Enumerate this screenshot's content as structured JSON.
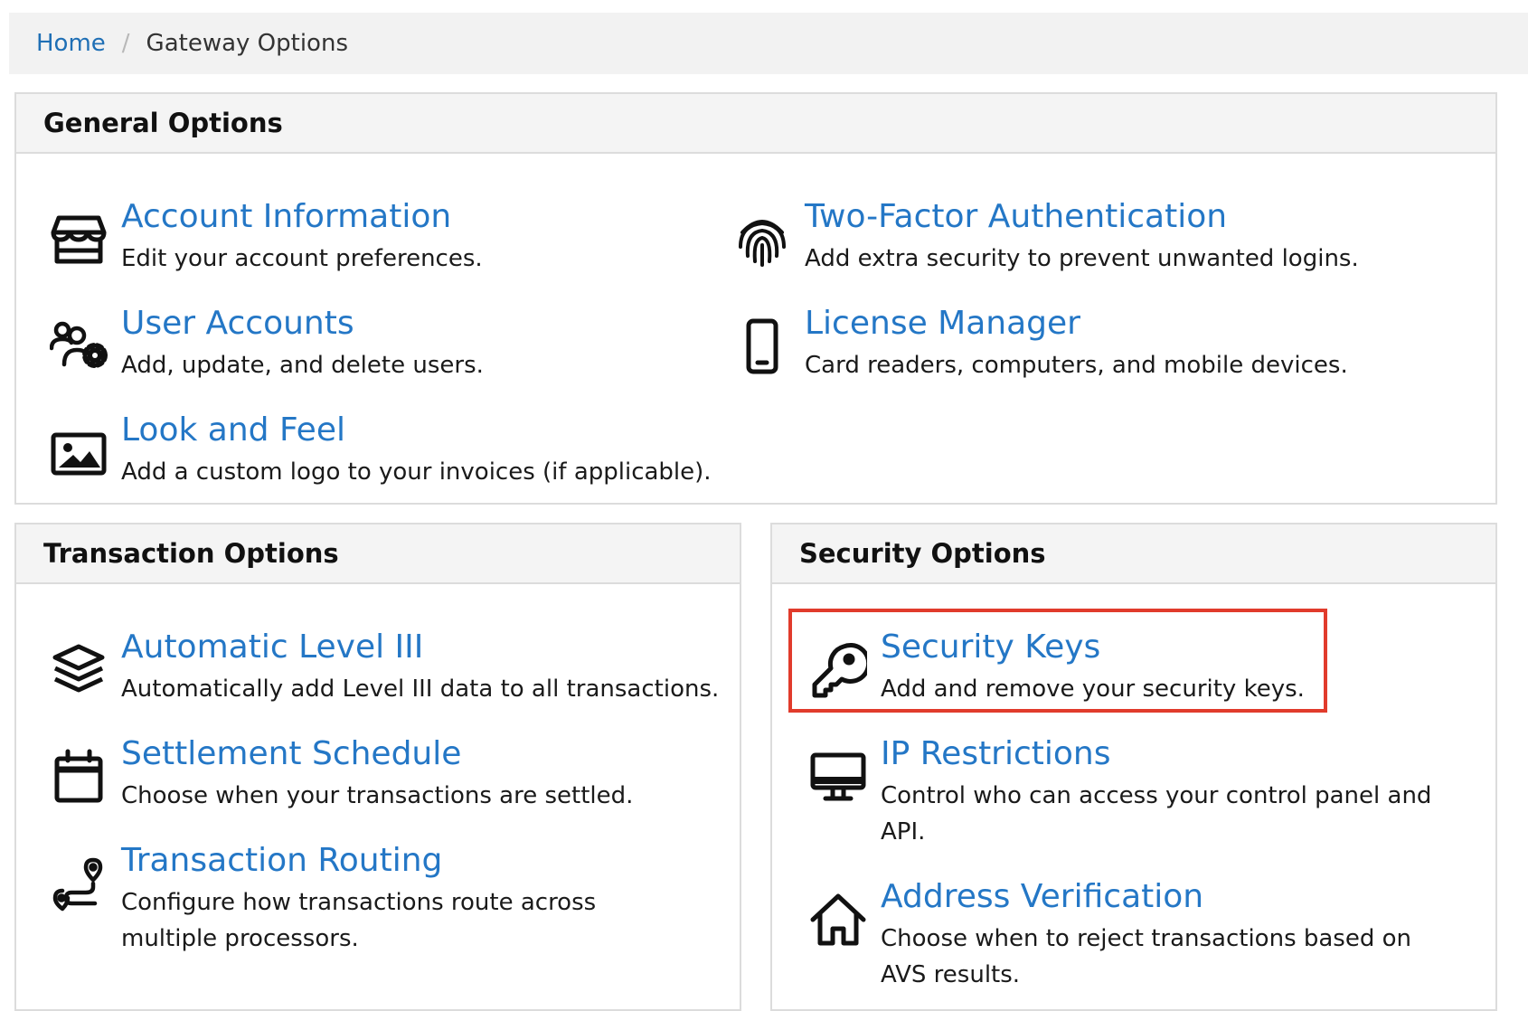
{
  "breadcrumb": {
    "home": "Home",
    "separator": "/",
    "current": "Gateway Options"
  },
  "general": {
    "title": "General Options",
    "items": [
      {
        "title": "Account Information",
        "desc": "Edit your account preferences.",
        "icon": "storefront-icon"
      },
      {
        "title": "Two-Factor Authentication",
        "desc": "Add extra security to prevent unwanted logins.",
        "icon": "fingerprint-icon"
      },
      {
        "title": "User Accounts",
        "desc": "Add, update, and delete users.",
        "icon": "users-gear-icon"
      },
      {
        "title": "License Manager",
        "desc": "Card readers, computers, and mobile devices.",
        "icon": "mobile-device-icon"
      },
      {
        "title": "Look and Feel",
        "desc": "Add a custom logo to your invoices (if applicable).",
        "icon": "image-icon"
      }
    ]
  },
  "transaction": {
    "title": "Transaction Options",
    "items": [
      {
        "title": "Automatic Level III",
        "desc": "Automatically add Level III data to all transactions.",
        "icon": "layers-icon"
      },
      {
        "title": "Settlement Schedule",
        "desc": "Choose when your transactions are settled.",
        "icon": "calendar-icon"
      },
      {
        "title": "Transaction Routing",
        "desc": "Configure how transactions route across multiple processors.",
        "icon": "route-icon"
      }
    ]
  },
  "security": {
    "title": "Security Options",
    "items": [
      {
        "title": "Security Keys",
        "desc": "Add and remove your security keys.",
        "icon": "key-icon"
      },
      {
        "title": "IP Restrictions",
        "desc": "Control who can access your control panel and API.",
        "icon": "monitor-icon"
      },
      {
        "title": "Address Verification",
        "desc": "Choose when to reject transactions based on AVS results.",
        "icon": "house-icon"
      }
    ]
  },
  "colors": {
    "link": "#2477c6",
    "highlight": "#e13b2c",
    "panel_header": "#f4f4f4"
  }
}
